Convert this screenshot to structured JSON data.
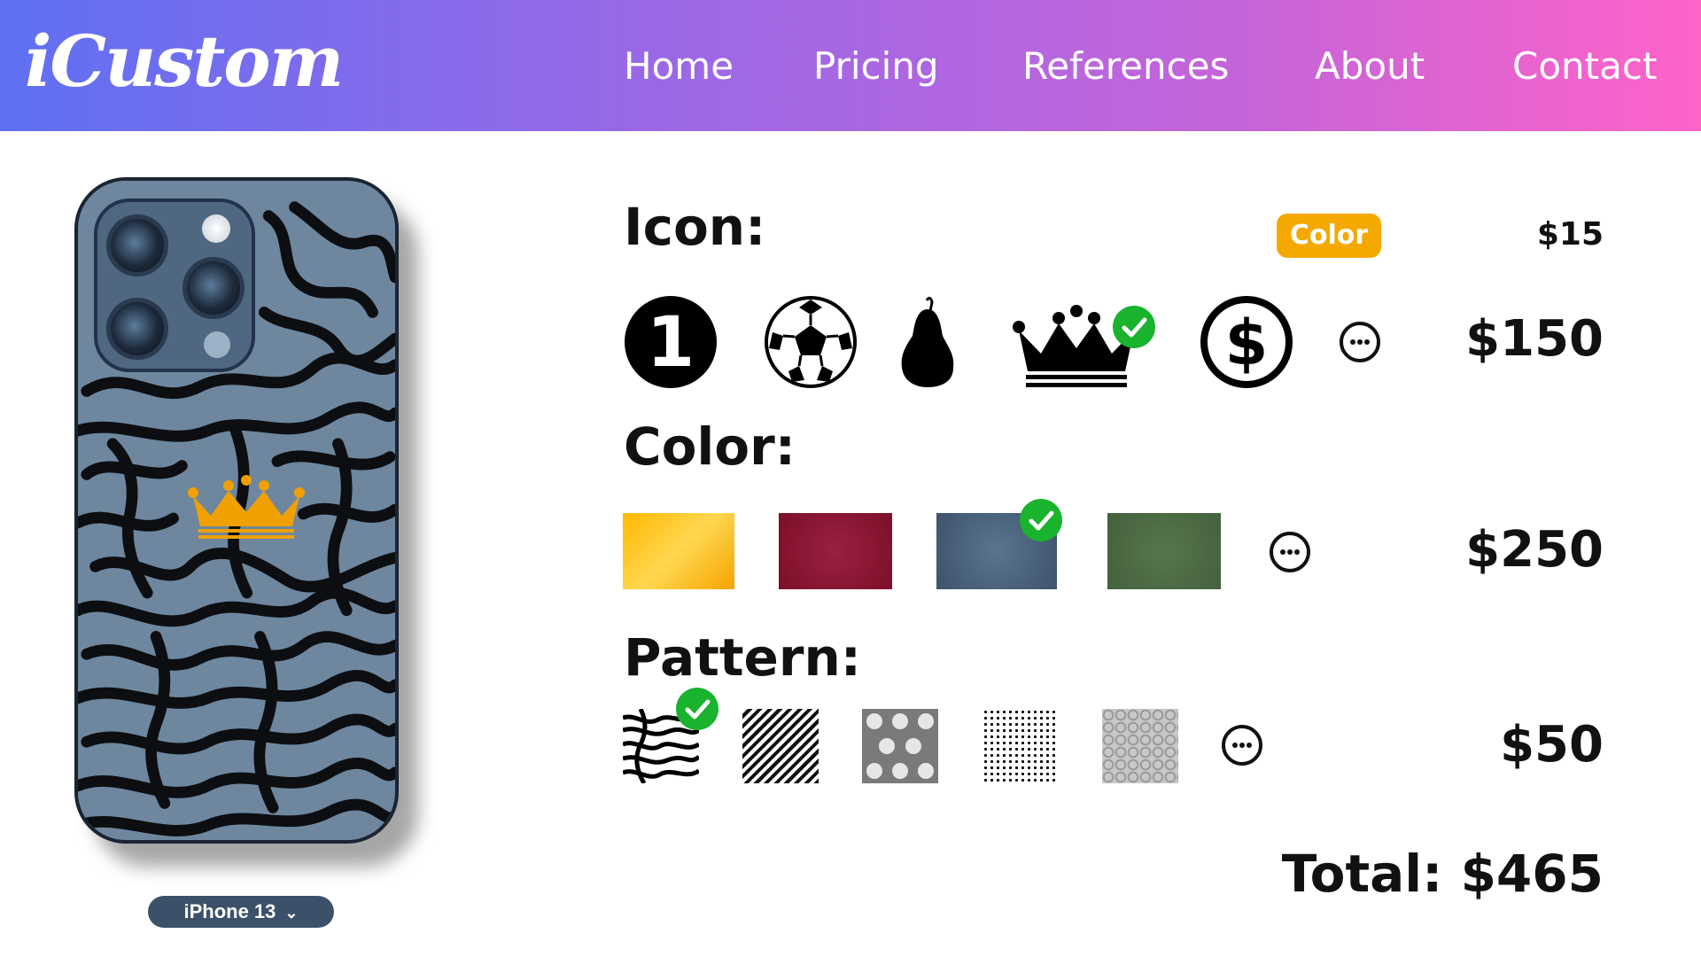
{
  "brand": {
    "logo": "iCustom"
  },
  "nav": [
    {
      "label": "Home"
    },
    {
      "label": "Pricing"
    },
    {
      "label": "References"
    },
    {
      "label": "About"
    },
    {
      "label": "Contact"
    }
  ],
  "phone": {
    "model": "iPhone 13",
    "chevron_icon": "chevron-down-icon"
  },
  "icon_section": {
    "label": "Icon:",
    "badge": "Color",
    "badge_price": "$15",
    "price": "$150",
    "options": [
      {
        "name": "number-one-icon"
      },
      {
        "name": "soccer-ball-icon"
      },
      {
        "name": "pear-icon"
      },
      {
        "name": "crown-icon",
        "selected": true
      },
      {
        "name": "dollar-sign-icon"
      }
    ],
    "more_icon": "more-options-icon"
  },
  "color_section": {
    "label": "Color:",
    "price": "$250",
    "swatches": [
      {
        "name": "yellow",
        "color": "#ffc020",
        "selected": false
      },
      {
        "name": "burgundy",
        "color": "#8e1530",
        "selected": false
      },
      {
        "name": "slate-blue",
        "color": "#475d77",
        "selected": true
      },
      {
        "name": "olive-green",
        "color": "#4c6a44",
        "selected": false
      }
    ],
    "more_icon": "more-options-icon"
  },
  "pattern_section": {
    "label": "Pattern:",
    "price": "$50",
    "patterns": [
      {
        "name": "zebra-pattern",
        "selected": true
      },
      {
        "name": "diagonal-stripes-pattern",
        "selected": false
      },
      {
        "name": "quatrefoil-pattern",
        "selected": false
      },
      {
        "name": "halftone-gradient-pattern",
        "selected": false
      },
      {
        "name": "circle-lattice-pattern",
        "selected": false
      }
    ],
    "more_icon": "more-options-icon"
  },
  "total": {
    "text": "Total: $465"
  },
  "colors": {
    "accent_badge": "#f5a800",
    "check": "#19b32d",
    "header_start": "#5f70f2",
    "header_end": "#ff63c8",
    "selected_crown": "#f0a000"
  }
}
